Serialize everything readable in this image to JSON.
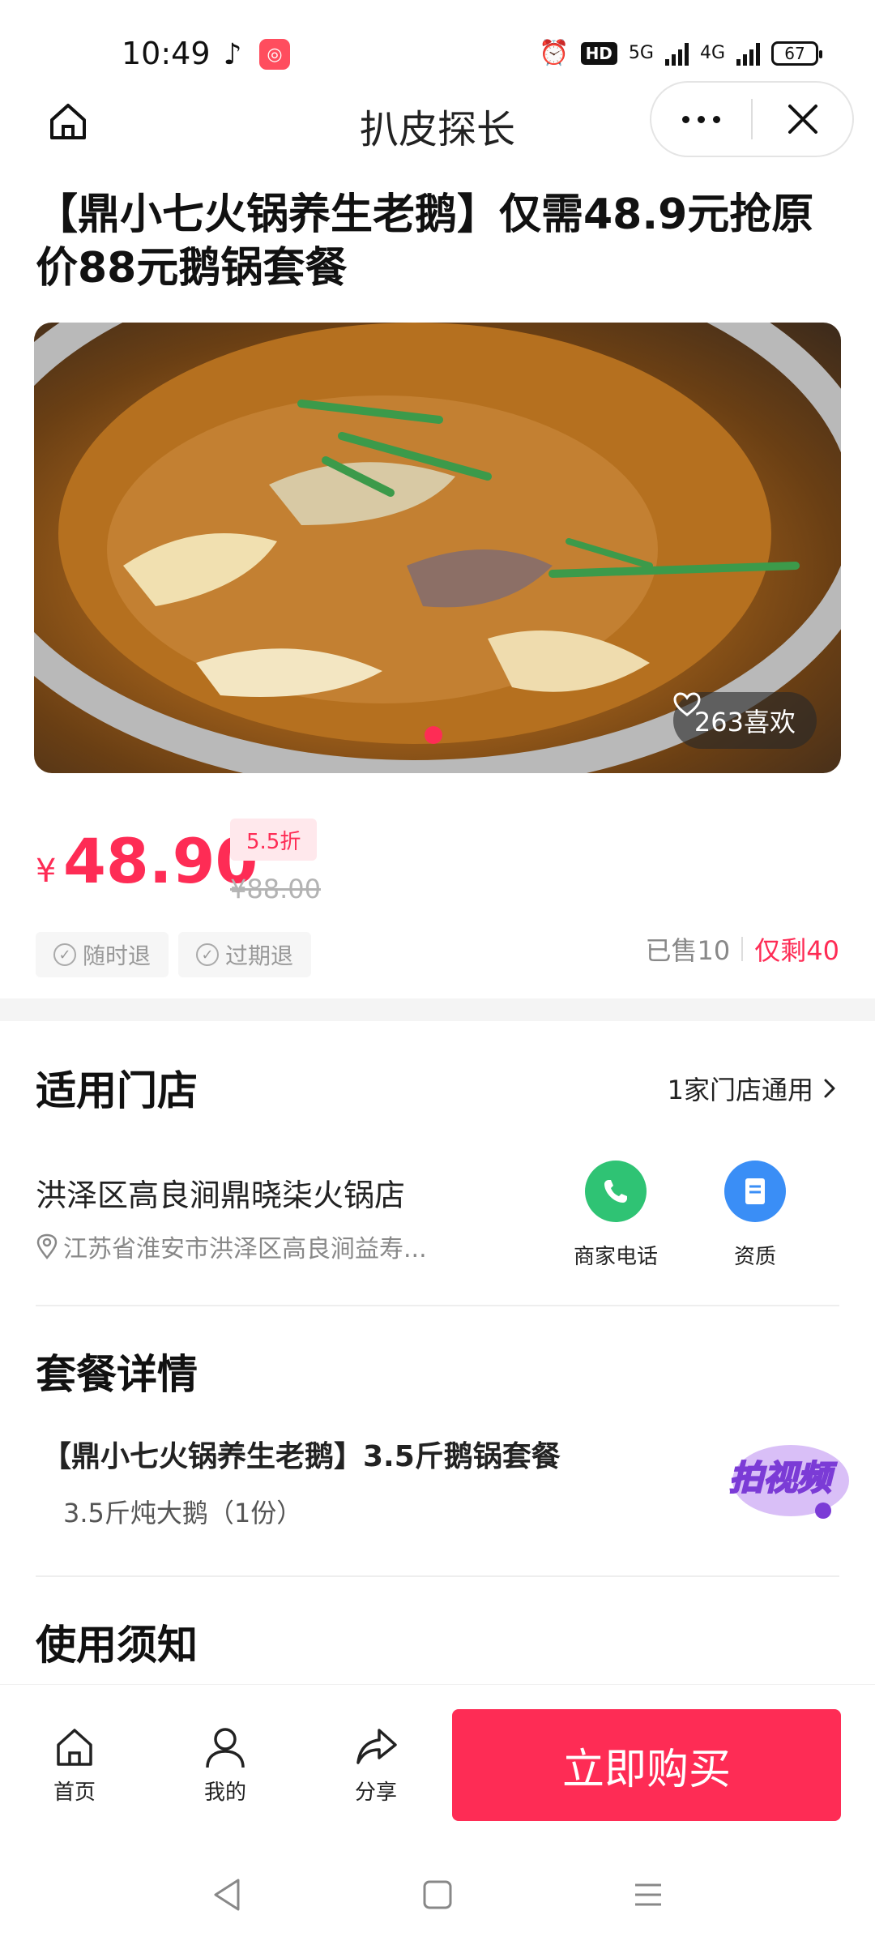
{
  "status_bar": {
    "time": "10:49",
    "app_icons": [
      "tiktok-icon",
      "app-icon"
    ],
    "network": "5G",
    "network2": "4G",
    "hd_label": "HD",
    "battery": "67"
  },
  "nav": {
    "title": "扒皮探长"
  },
  "product": {
    "title": "【鼎小七火锅养生老鹅】仅需48.9元抢原价88元鹅锅套餐",
    "likes": "263喜欢",
    "price_symbol": "¥",
    "price": "48.90",
    "discount": "5.5折",
    "original_price": "¥88.00",
    "tags": [
      "随时退",
      "过期退"
    ],
    "sold": "已售10",
    "remaining": "仅剩40"
  },
  "stores": {
    "section_title": "适用门店",
    "count_label": "1家门店通用",
    "store_name": "洪泽区高良涧鼎晓柒火锅店",
    "store_address": "江苏省淮安市洪泽区高良涧益寿...",
    "phone_label": "商家电话",
    "license_label": "资质"
  },
  "package": {
    "section_title": "套餐详情",
    "name": "【鼎小七火锅养生老鹅】3.5斤鹅锅套餐",
    "item": "3.5斤炖大鹅（1份）",
    "video_badge": "拍视频"
  },
  "notice": {
    "section_title": "使用须知"
  },
  "bottom_bar": {
    "home_label": "首页",
    "mine_label": "我的",
    "share_label": "分享",
    "buy_label": "立即购买"
  },
  "colors": {
    "accent": "#fe2c55",
    "phone_icon_bg": "#2fc374",
    "license_icon_bg": "#3a8ef6"
  }
}
